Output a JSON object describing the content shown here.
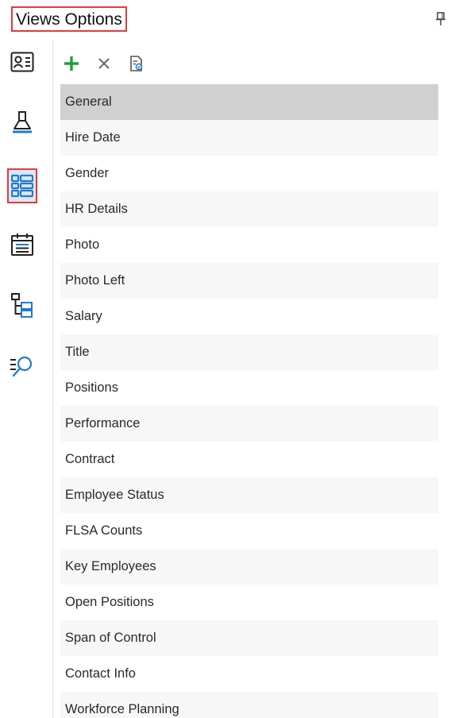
{
  "panel": {
    "title": "Views Options"
  },
  "sidebar": {
    "items": [
      {
        "icon": "contact-card-icon",
        "active": false
      },
      {
        "icon": "paint-brush-icon",
        "active": false
      },
      {
        "icon": "views-list-icon",
        "active": true
      },
      {
        "icon": "calendar-icon",
        "active": false
      },
      {
        "icon": "tree-structure-icon",
        "active": false
      },
      {
        "icon": "search-list-icon",
        "active": false
      }
    ]
  },
  "toolbar": {
    "icons": [
      "add-icon",
      "delete-icon",
      "properties-icon"
    ]
  },
  "views": {
    "selected_index": 0,
    "items": [
      "General",
      "Hire Date",
      "Gender",
      "HR Details",
      "Photo",
      "Photo Left",
      "Salary",
      "Title",
      "Positions",
      "Performance",
      "Contract",
      "Employee Status",
      "FLSA Counts",
      "Key Employees",
      "Open Positions",
      "Span of Control",
      "Contact Info",
      "Workforce Planning"
    ]
  },
  "colors": {
    "accent_red": "#e23a3a",
    "add_green": "#1f9e3a",
    "icon_blue": "#1f7bd1",
    "selected_row": "#d0d0d0"
  }
}
